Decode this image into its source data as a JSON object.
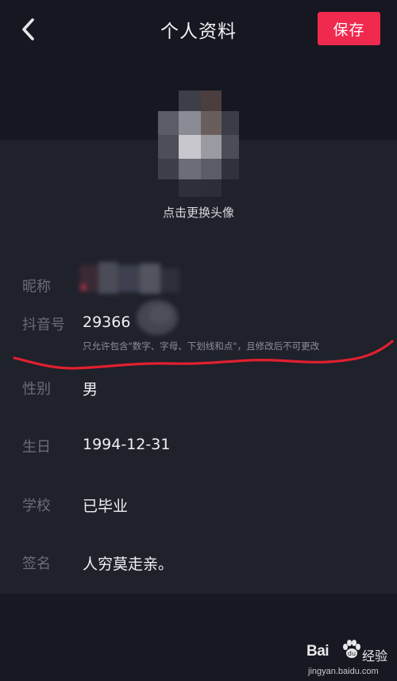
{
  "header": {
    "title": "个人资料",
    "save_label": "保存",
    "back_icon": "chevron-left-icon"
  },
  "avatar": {
    "hint": "点击更换头像"
  },
  "profile": {
    "nickname_label": "昵称",
    "douyin_id_label": "抖音号",
    "douyin_id_value": "29366",
    "douyin_id_hint": "只允许包含\"数字、字母、下划线和点\"，且修改后不可更改",
    "gender_label": "性别",
    "gender_value": "男",
    "birthday_label": "生日",
    "birthday_value": "1994-12-31",
    "school_label": "学校",
    "school_value": "已毕业",
    "signature_label": "签名",
    "signature_value": "人穷莫走亲。"
  },
  "watermark": {
    "logo": "Bai",
    "brand": "经验",
    "url": "jingyan.baidu.com"
  },
  "colors": {
    "background": "#16171f",
    "panel": "#1f212b",
    "accent": "#f0294f",
    "annotation": "#e0202e"
  }
}
